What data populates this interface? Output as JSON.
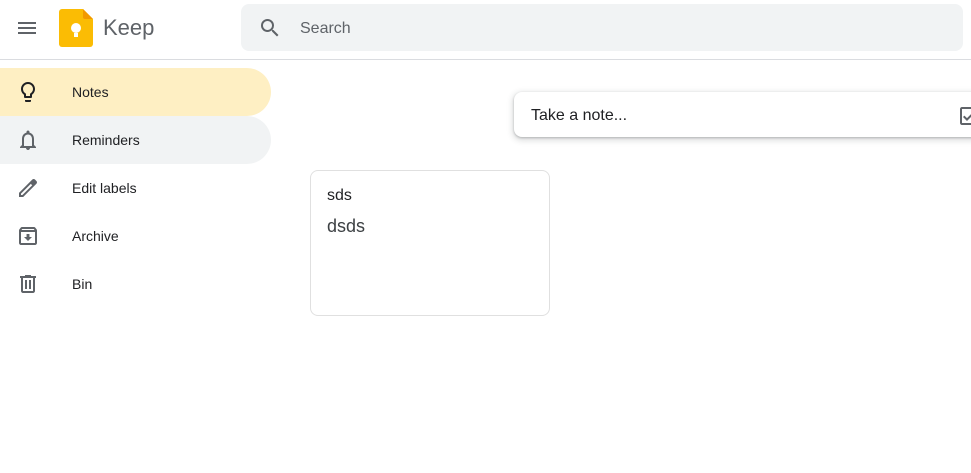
{
  "header": {
    "app_title": "Keep",
    "menu_icon": "hamburger-menu-icon",
    "logo": "keep-logo-icon",
    "search": {
      "placeholder": "Search",
      "value": "",
      "icon": "search-icon"
    }
  },
  "sidebar": {
    "items": [
      {
        "label": "Notes",
        "icon": "lightbulb-icon",
        "state": "active"
      },
      {
        "label": "Reminders",
        "icon": "bell-icon",
        "state": "hover"
      },
      {
        "label": "Edit labels",
        "icon": "pencil-icon",
        "state": "normal"
      },
      {
        "label": "Archive",
        "icon": "archive-icon",
        "state": "normal"
      },
      {
        "label": "Bin",
        "icon": "trash-icon",
        "state": "normal"
      }
    ]
  },
  "composer": {
    "placeholder": "Take a note...",
    "checkbox_icon": "checkbox-icon"
  },
  "notes": [
    {
      "title": "sds",
      "body": "dsds"
    }
  ],
  "colors": {
    "active": "#feefc3",
    "hover": "#f1f3f4",
    "logo_yellow": "#fbbc04",
    "icon_gray": "#5f6368"
  }
}
